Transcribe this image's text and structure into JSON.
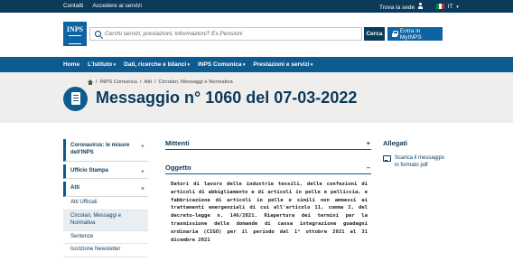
{
  "topbar": {
    "links": [
      "Contatti",
      "Accedere ai servizi"
    ],
    "find_office": "Trova la sede",
    "language": "IT",
    "flag_colors": [
      "#009246",
      "#ffffff",
      "#ce2b37"
    ]
  },
  "header": {
    "logo_text": "INPS",
    "search_placeholder": "Cerchi servizi, prestazioni, informazioni? Es.Pensioni",
    "search_button": "Cerca",
    "login_button": "Entra in MyINPS"
  },
  "nav": {
    "items": [
      "Home",
      "L'Istituto",
      "Dati, ricerche e bilanci",
      "INPS Comunica",
      "Prestazioni e servizi"
    ]
  },
  "breadcrumb": [
    "INPS Comunica",
    "Atti",
    "Circolari, Messaggi e Normativa"
  ],
  "page_title": "Messaggio n° 1060 del 07-03-2022",
  "sidebar": {
    "sections": [
      {
        "label": "Coronavirus: le misure dell'INPS",
        "toggle": "+"
      },
      {
        "label": "Ufficio Stampa",
        "toggle": "+"
      },
      {
        "label": "Atti",
        "toggle": "×"
      }
    ],
    "subitems": [
      "Atti Ufficiali",
      "Circolari, Messaggi e Normativa",
      "Sentenze",
      "Iscrizione Newsletter"
    ]
  },
  "content": {
    "mittenti": {
      "label": "Mittenti",
      "toggle": "+"
    },
    "oggetto": {
      "label": "Oggetto",
      "toggle": "–",
      "text": "Datori di lavoro delle industrie tessili, delle confezioni di articoli di abbigliamento e di articoli in pelle e pelliccia, e fabbricazione di articoli in pelle e simili non ammessi ai trattamenti emergenziali di cui all'articolo 11, comma 2, del decreto-legge n. 146/2021. Riapertura dei termini per la trasmissione delle domande di cassa integrazione guadagni ordinaria (CIGO) per il periodo dal 1° ottobre 2021 al 31 dicembre 2021"
    }
  },
  "aside": {
    "title": "Allegati",
    "attachment": "Scarica il messaggio in formato pdf"
  },
  "colors": {
    "brand_dark": "#0b3a5b",
    "brand": "#0e5c8f",
    "band_bg": "#efeeec"
  }
}
